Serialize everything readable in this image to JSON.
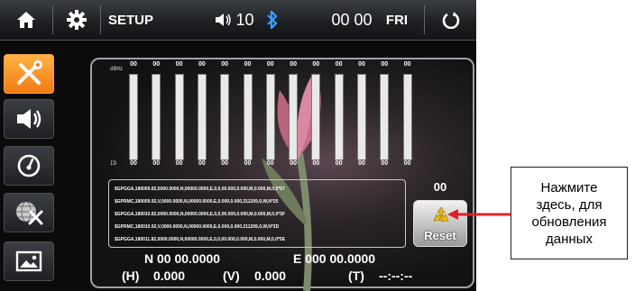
{
  "topbar": {
    "setup_label": "SETUP",
    "volume": "10",
    "time": "00 00",
    "day": "FRI",
    "icons": [
      "home-icon",
      "gear-icon",
      "volume-icon",
      "bluetooth-icon",
      "power-icon"
    ]
  },
  "sidebar": {
    "items": [
      {
        "icon": "tools-icon",
        "active": true
      },
      {
        "icon": "speaker-icon",
        "active": false
      },
      {
        "icon": "gauge-icon",
        "active": false
      },
      {
        "icon": "globe-tools-icon",
        "active": false
      },
      {
        "icon": "picture-icon",
        "active": false
      }
    ]
  },
  "gps": {
    "dbhz_label": "dBHz",
    "id_label": "ID",
    "signals": [
      "00",
      "00",
      "00",
      "00",
      "00",
      "00",
      "00",
      "00",
      "00",
      "00",
      "00",
      "00",
      "00"
    ],
    "ids": [
      "00",
      "00",
      "00",
      "00",
      "00",
      "00",
      "00",
      "00",
      "00",
      "00",
      "00",
      "00",
      "00"
    ],
    "nmea": [
      "$GPGGA,180009.82,0000.0000,N,00000.0000,E,0,0,00.000,0.000,M,0.000,M,0,0*57",
      "$GPRMC,180009.92,V,0000.0000,N,00000.0000,E,0.000,0.000,311209,0,W,N*25",
      "$GPGGA,180010.82,0000.0000,N,00000.0000,E,0,0,00.000,0.000,M,0.000,M,0,0*5F",
      "$GPRMC,180010.92,V,0000.0000,N,00000.0000,E,0.000,0.000,311209,0,W,N*2D",
      "$GPGGA,180011.82,0000.0000,N,00000.0000,E,0,0,00.000,0.000,M,0.000,M,0,0*5E"
    ],
    "satellite_count": "00",
    "reset_label": "Reset",
    "latitude": "N 00 00.0000",
    "longitude": "E 000 00.0000",
    "h_label": "(H)",
    "h_value": "0.000",
    "v_label": "(V)",
    "v_value": "0.000",
    "t_label": "(T)",
    "t_value": "--:--:--"
  },
  "callout": {
    "text": "Нажмите\nздесь, для\nобновления\nданных",
    "arrow_color": "#e0202a"
  },
  "colors": {
    "accent": "#f07b10",
    "bar": "#3aa0ff",
    "bluetooth": "#3aa0ff"
  }
}
